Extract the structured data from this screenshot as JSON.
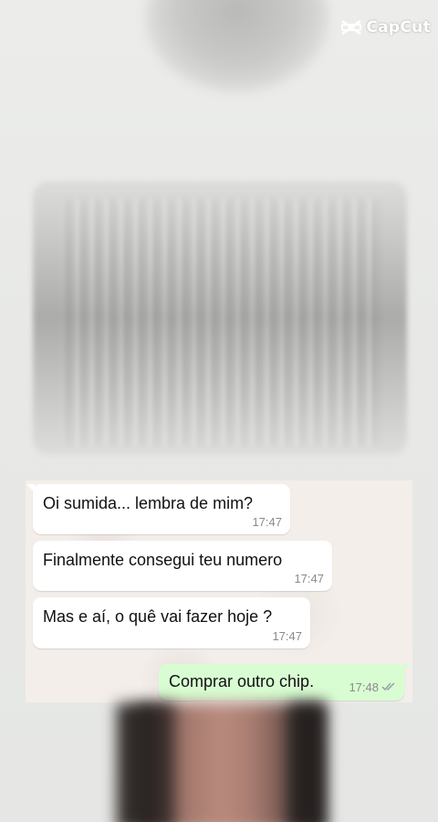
{
  "watermark": {
    "brand": "CapCut",
    "icon": "capcut-logo-icon"
  },
  "chat": {
    "messages": [
      {
        "direction": "incoming",
        "text": "Oi sumida... lembra de mim?",
        "time": "17:47"
      },
      {
        "direction": "incoming",
        "text": "Finalmente consegui teu numero",
        "time": "17:47"
      },
      {
        "direction": "incoming",
        "text": "Mas e aí, o quê vai fazer hoje ?",
        "time": "17:47"
      },
      {
        "direction": "outgoing",
        "text": "Comprar outro chip.",
        "time": "17:48",
        "status_icon": "double-check-icon"
      }
    ],
    "colors": {
      "incoming_bubble": "#ffffff",
      "outgoing_bubble": "#d9fdd3",
      "timestamp": "#8a8a8a",
      "chat_background": "#f3eeea"
    }
  }
}
